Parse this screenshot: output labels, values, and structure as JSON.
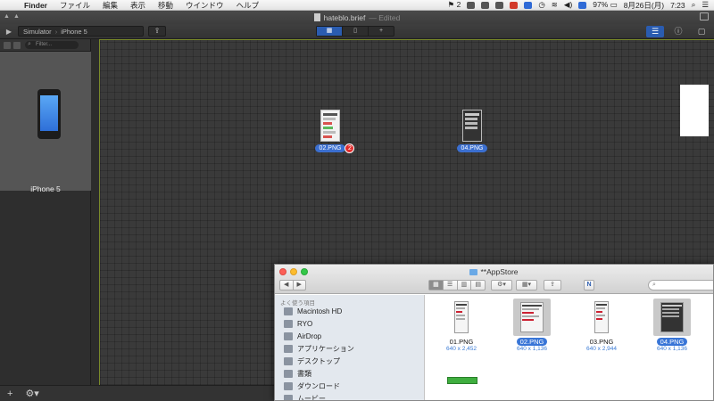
{
  "menubar": {
    "app": "Finder",
    "items": [
      "ファイル",
      "編集",
      "表示",
      "移動",
      "ウインドウ",
      "ヘルプ"
    ],
    "notif_count": "2",
    "battery": "97%",
    "date": "8月26日(月)",
    "time": "7:23"
  },
  "app": {
    "title": "hateblo.brief",
    "edited": "— Edited",
    "scheme_target": "Simulator",
    "scheme_device": "iPhone 5",
    "filter_placeholder": "Filter...",
    "device_name": "iPhone 5",
    "nodes": [
      {
        "label": "02.PNG",
        "badge": "2"
      },
      {
        "label": "04.PNG"
      }
    ],
    "accent": "#2a5cb0"
  },
  "finder": {
    "title": "**AppStore",
    "sidebar_header": "よく使う項目",
    "favorites": [
      "Macintosh HD",
      "RYO",
      "AirDrop",
      "アプリケーション",
      "デスクトップ",
      "書類",
      "ダウンロード",
      "ムービー"
    ],
    "files": [
      {
        "name": "01.PNG",
        "dims": "640 x 2,452",
        "selected": false
      },
      {
        "name": "02.PNG",
        "dims": "640 x 1,136",
        "selected": true
      },
      {
        "name": "03.PNG",
        "dims": "640 x 2,944",
        "selected": false
      },
      {
        "name": "04.PNG",
        "dims": "640 x 1,136",
        "selected": true
      }
    ]
  }
}
